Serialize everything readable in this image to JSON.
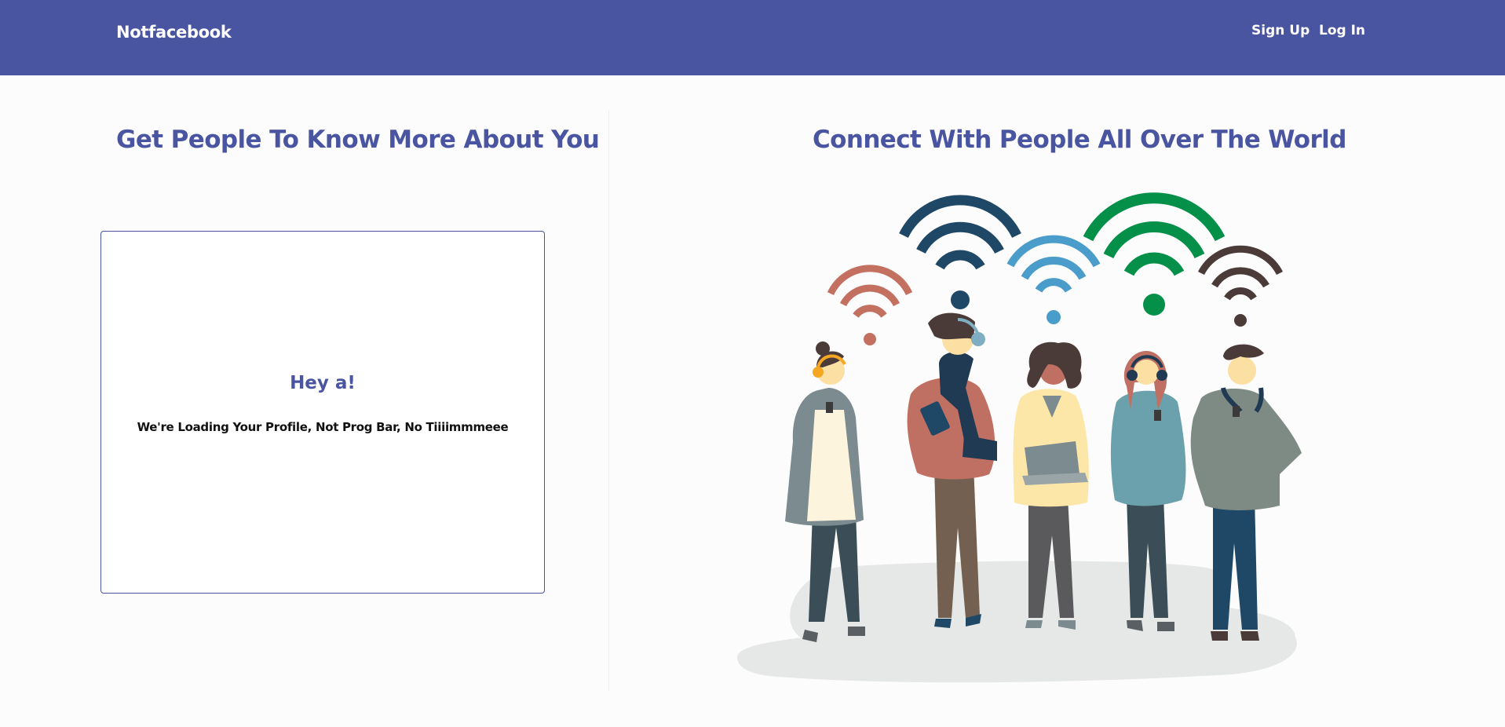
{
  "navbar": {
    "brand": "Notfacebook",
    "links": [
      {
        "label": "Sign Up"
      },
      {
        "label": "Log In"
      }
    ],
    "color": "#4a55a2"
  },
  "left": {
    "heading": "Get People To Know More About You",
    "card": {
      "title": "Hey a!",
      "message": "We're Loading Your Profile, Not Prog Bar, No Tiiiimmmeee"
    }
  },
  "right": {
    "heading": "Connect With People All Over The World",
    "illustration": "people-with-wifi-illustration"
  },
  "colors": {
    "accent": "#4a55a2",
    "background": "#fcfcfc"
  }
}
